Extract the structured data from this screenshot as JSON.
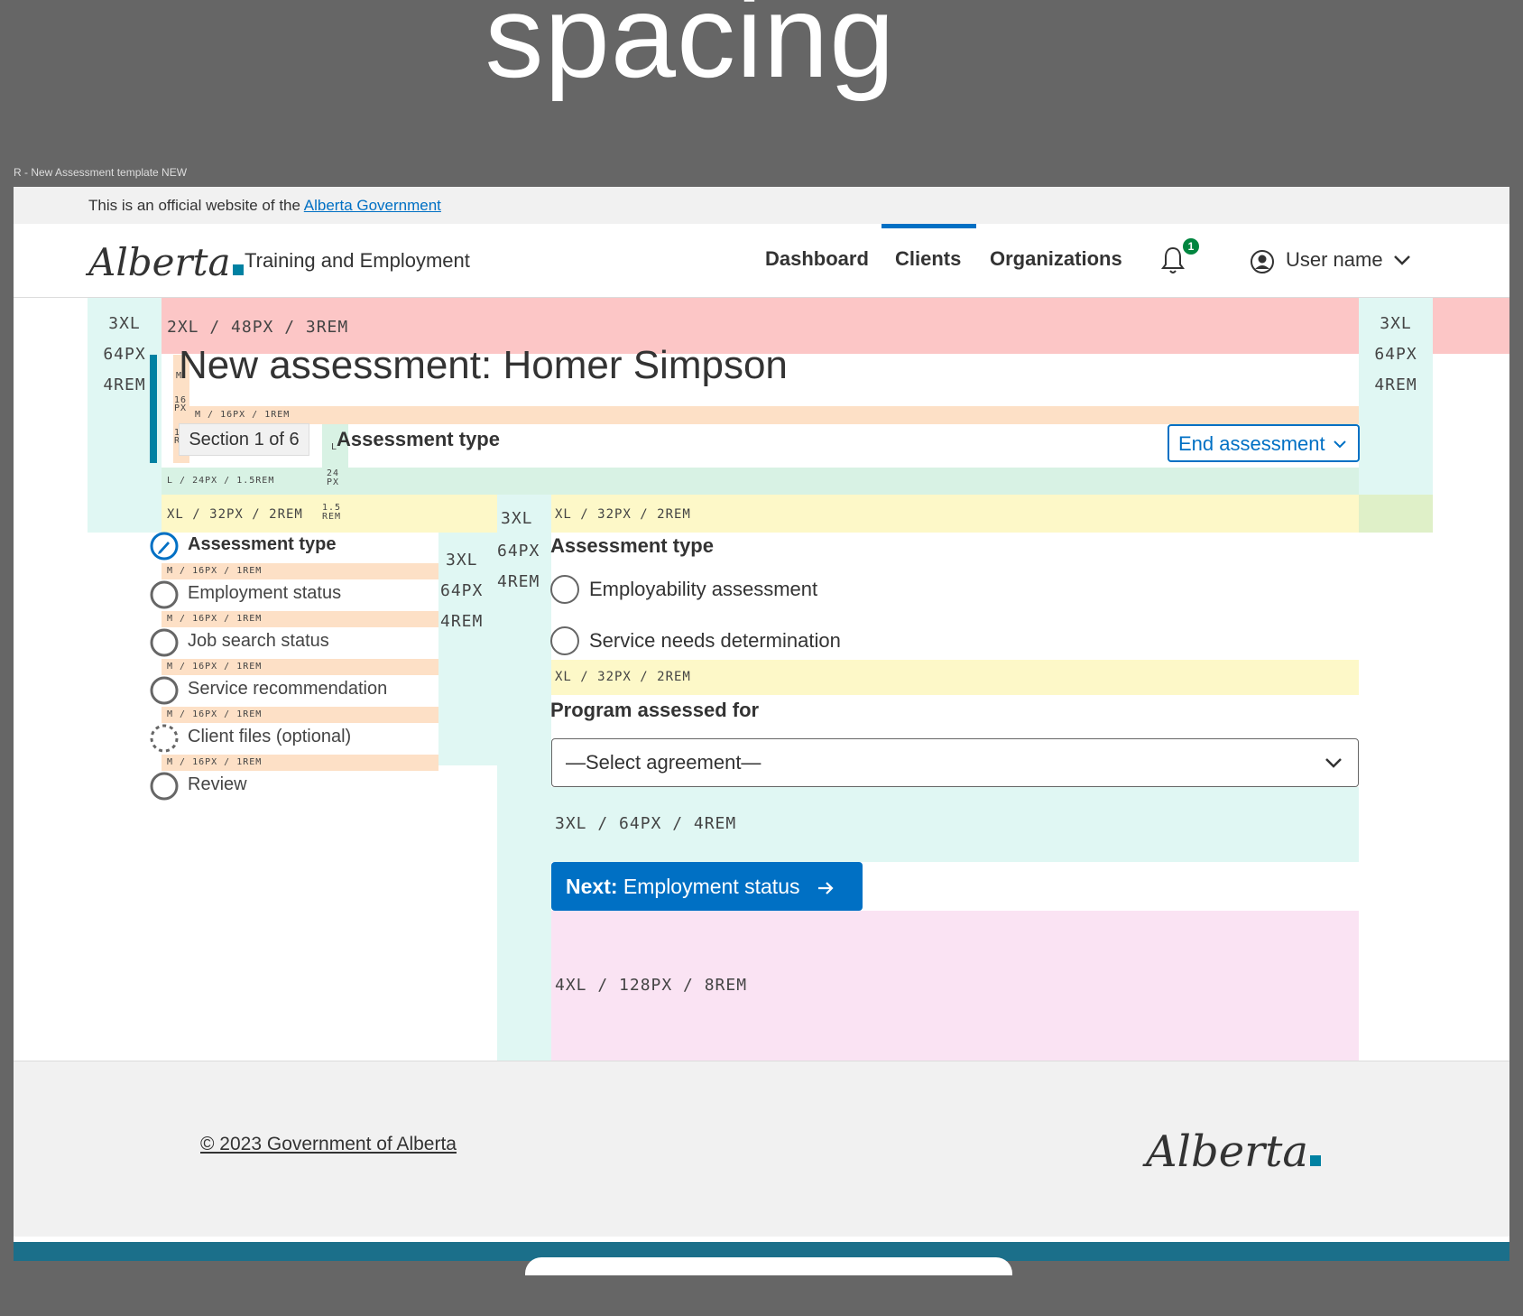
{
  "page_heading": "spacing",
  "frame_label": "R - New Assessment template NEW",
  "official_banner": {
    "text": "This is an official website of the",
    "link": "Alberta Government"
  },
  "header": {
    "logo": "Alberta",
    "service_name": "Training and Employment",
    "nav": [
      "Dashboard",
      "Clients",
      "Organizations"
    ],
    "active_nav": "Clients",
    "notification_count": "1",
    "user_name": "User name"
  },
  "annotations": {
    "side_3xl": [
      "3XL",
      "64PX",
      "4REM"
    ],
    "spacing_2xl": "2XL / 48PX / 3REM",
    "m_short": "M",
    "px16": [
      "16",
      "PX"
    ],
    "m_16_1rem": "M / 16PX / 1REM",
    "rem1": [
      "1",
      "REM"
    ],
    "l_short": "L",
    "l_24_15rem": "L / 24PX / 1.5REM",
    "px24": [
      "24",
      "PX"
    ],
    "xl_32_2rem": "XL / 32PX / 2REM",
    "rem15": [
      "1.5",
      "REM"
    ],
    "xl3": "3XL",
    "px64": "64PX",
    "rem4": "4REM",
    "spacing_3xl": "3XL / 64PX / 4REM",
    "spacing_4xl": "4XL / 128PX / 8REM"
  },
  "assessment": {
    "title": "New assessment: Homer Simpson",
    "section_tag": "Section 1 of 6",
    "section_heading": "Assessment type",
    "end_button": "End assessment"
  },
  "steps": [
    {
      "label": "Assessment type",
      "state": "current"
    },
    {
      "label": "Employment status",
      "state": "todo"
    },
    {
      "label": "Job search status",
      "state": "todo"
    },
    {
      "label": "Service recommendation",
      "state": "todo"
    },
    {
      "label": "Client files (optional)",
      "state": "optional"
    },
    {
      "label": "Review",
      "state": "todo"
    }
  ],
  "form": {
    "heading": "Assessment type",
    "radio_options": [
      "Employability assessment",
      "Service needs determination"
    ],
    "program_label": "Program assessed for",
    "select_value": "—Select agreement—",
    "next_prefix": "Next:",
    "next_label": "Employment status"
  },
  "footer": {
    "copyright": "© 2023 Government of Alberta",
    "logo": "Alberta"
  },
  "colors": {
    "brand_blue": "#0070c4",
    "teal_accent": "#0081a2",
    "footer_band": "#1b6f8a",
    "badge_green": "#00853f"
  }
}
